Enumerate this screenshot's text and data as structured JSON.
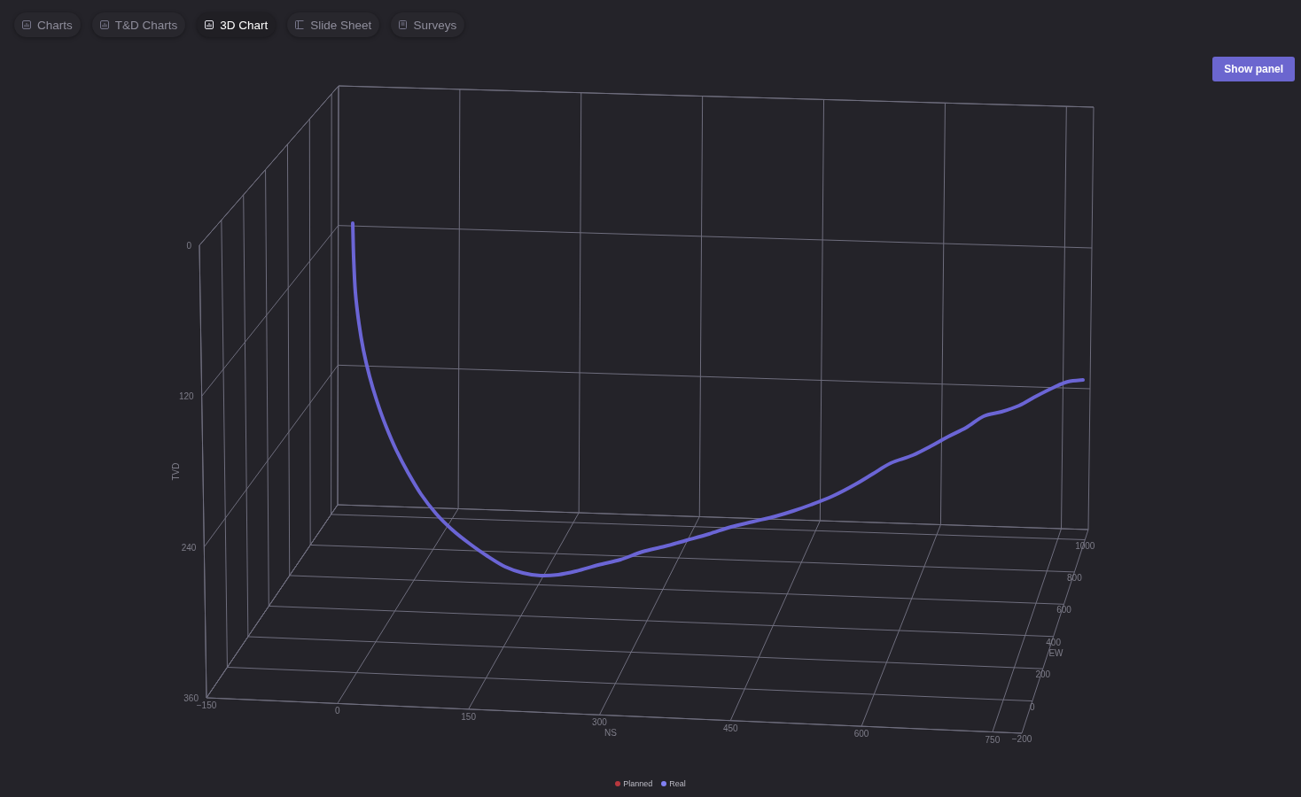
{
  "tabs": [
    {
      "label": "Charts",
      "selected": false
    },
    {
      "label": "T&D Charts",
      "selected": false
    },
    {
      "label": "3D Chart",
      "selected": true
    },
    {
      "label": "Slide Sheet",
      "selected": false
    },
    {
      "label": "Surveys",
      "selected": false
    }
  ],
  "show_panel_button": "Show panel",
  "chart": {
    "axes": [
      {
        "kind": "vertical",
        "title": "TVD",
        "ticks": [
          "0",
          "120",
          "240",
          "360"
        ]
      },
      {
        "kind": "horizontal",
        "title": "NS",
        "ticks": [
          "−150",
          "0",
          "150",
          "300",
          "450",
          "600",
          "750"
        ]
      },
      {
        "kind": "depth",
        "title": "EW",
        "ticks": [
          "−200",
          "0",
          "200",
          "400",
          "600",
          "800",
          "1000"
        ]
      }
    ],
    "legend": [
      {
        "label": "Planned",
        "color": "#b8383e"
      },
      {
        "label": "Real",
        "color": "#8180f2"
      }
    ]
  }
}
